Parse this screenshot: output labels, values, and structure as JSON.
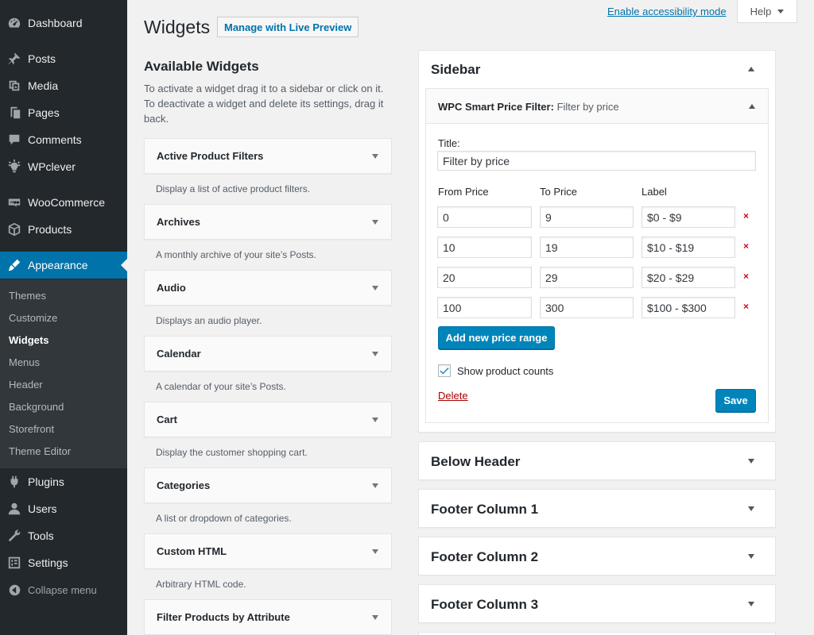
{
  "menu": {
    "items": [
      {
        "label": "Dashboard",
        "icon": "dashboard-icon"
      },
      {
        "label": "Posts",
        "icon": "pin-icon"
      },
      {
        "label": "Media",
        "icon": "media-icon"
      },
      {
        "label": "Pages",
        "icon": "pages-icon"
      },
      {
        "label": "Comments",
        "icon": "comment-icon"
      },
      {
        "label": "WPclever",
        "icon": "lightbulb-icon"
      },
      {
        "label": "WooCommerce",
        "icon": "woo-icon"
      },
      {
        "label": "Products",
        "icon": "box-icon"
      },
      {
        "label": "Appearance",
        "icon": "brush-icon"
      },
      {
        "label": "Plugins",
        "icon": "plug-icon"
      },
      {
        "label": "Users",
        "icon": "user-icon"
      },
      {
        "label": "Tools",
        "icon": "wrench-icon"
      },
      {
        "label": "Settings",
        "icon": "settings-icon"
      }
    ],
    "submenu": [
      "Themes",
      "Customize",
      "Widgets",
      "Menus",
      "Header",
      "Background",
      "Storefront",
      "Theme Editor"
    ],
    "collapse_label": "Collapse menu"
  },
  "header": {
    "title": "Widgets",
    "live_preview": "Manage with Live Preview",
    "accessibility": "Enable accessibility mode",
    "help": "Help"
  },
  "available": {
    "title": "Available Widgets",
    "description": "To activate a widget drag it to a sidebar or click on it. To deactivate a widget and delete its settings, drag it back.",
    "widgets": [
      {
        "title": "Active Product Filters",
        "desc": "Display a list of active product filters."
      },
      {
        "title": "Archives",
        "desc": "A monthly archive of your site’s Posts."
      },
      {
        "title": "Audio",
        "desc": "Displays an audio player."
      },
      {
        "title": "Calendar",
        "desc": "A calendar of your site’s Posts."
      },
      {
        "title": "Cart",
        "desc": "Display the customer shopping cart."
      },
      {
        "title": "Categories",
        "desc": "A list or dropdown of categories."
      },
      {
        "title": "Custom HTML",
        "desc": "Arbitrary HTML code."
      },
      {
        "title": "Filter Products by Attribute",
        "desc": ""
      }
    ]
  },
  "sidebar": {
    "title": "Sidebar",
    "widget": {
      "name": "WPC Smart Price Filter:",
      "subtitle": "Filter by price",
      "title_label": "Title:",
      "title_value": "Filter by price",
      "col_from": "From Price",
      "col_to": "To Price",
      "col_label": "Label",
      "ranges": [
        {
          "from": "0",
          "to": "9",
          "label": "$0 - $9"
        },
        {
          "from": "10",
          "to": "19",
          "label": "$10 - $19"
        },
        {
          "from": "20",
          "to": "29",
          "label": "$20 - $29"
        },
        {
          "from": "100",
          "to": "300",
          "label": "$100 - $300"
        }
      ],
      "remove_symbol": "×",
      "add_range": "Add new price range",
      "show_counts": "Show product counts",
      "show_counts_checked": true,
      "delete": "Delete",
      "save": "Save"
    }
  },
  "other_sidebars": [
    "Below Header",
    "Footer Column 1",
    "Footer Column 2",
    "Footer Column 3"
  ]
}
